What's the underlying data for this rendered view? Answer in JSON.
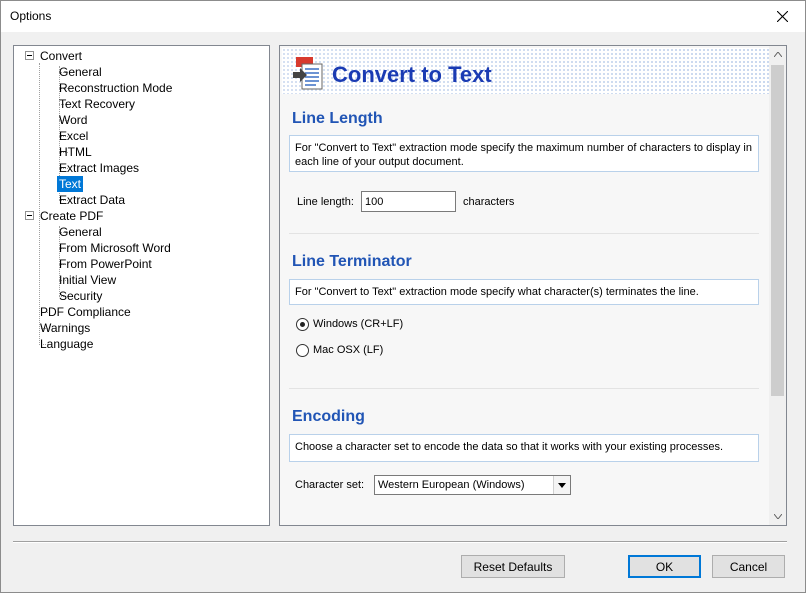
{
  "window": {
    "title": "Options"
  },
  "tree": {
    "items": [
      {
        "label": "Convert",
        "level": 0,
        "expandable": true
      },
      {
        "label": "General",
        "level": 1
      },
      {
        "label": "Reconstruction Mode",
        "level": 1
      },
      {
        "label": "Text Recovery",
        "level": 1
      },
      {
        "label": "Word",
        "level": 1
      },
      {
        "label": "Excel",
        "level": 1
      },
      {
        "label": "HTML",
        "level": 1
      },
      {
        "label": "Extract Images",
        "level": 1
      },
      {
        "label": "Text",
        "level": 1,
        "selected": true
      },
      {
        "label": "Extract Data",
        "level": 1
      },
      {
        "label": "Create PDF",
        "level": 0,
        "expandable": true
      },
      {
        "label": "General",
        "level": 1
      },
      {
        "label": "From Microsoft Word",
        "level": 1
      },
      {
        "label": "From PowerPoint",
        "level": 1
      },
      {
        "label": "Initial View",
        "level": 1
      },
      {
        "label": "Security",
        "level": 1
      },
      {
        "label": "PDF Compliance",
        "level": 0
      },
      {
        "label": "Warnings",
        "level": 0
      },
      {
        "label": "Language",
        "level": 0
      }
    ]
  },
  "panel": {
    "title": "Convert to Text",
    "line_length": {
      "heading": "Line Length",
      "description": "For \"Convert to Text\" extraction mode specify the maximum number of characters to display in each line of your output document.",
      "field_label": "Line length:",
      "field_value": "100",
      "unit": "characters"
    },
    "line_terminator": {
      "heading": "Line Terminator",
      "description": "For \"Convert to Text\" extraction mode specify what character(s) terminates the line.",
      "options": [
        "Windows (CR+LF)",
        "Mac OSX (LF)"
      ],
      "selected": "Windows (CR+LF)"
    },
    "encoding": {
      "heading": "Encoding",
      "description": "Choose a character set to encode the data so that it works with your existing processes.",
      "field_label": "Character set:",
      "selected": "Western European (Windows)"
    }
  },
  "buttons": {
    "reset": "Reset Defaults",
    "ok": "OK",
    "cancel": "Cancel"
  },
  "colors": {
    "accent": "#0078d7",
    "heading": "#2155b5",
    "title": "#1a3bb3"
  }
}
